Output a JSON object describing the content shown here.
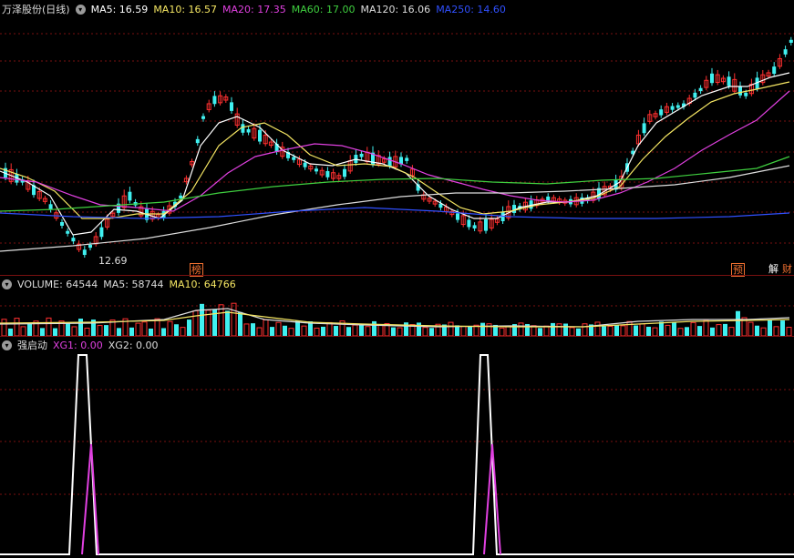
{
  "main": {
    "title": "万泽股份(日线)",
    "ma": [
      {
        "label": "MA5: 16.59",
        "color": "#ffffff"
      },
      {
        "label": "MA10: 16.57",
        "color": "#f5e663"
      },
      {
        "label": "MA20: 17.35",
        "color": "#e040e0"
      },
      {
        "label": "MA60: 17.00",
        "color": "#3fcf3f"
      },
      {
        "label": "MA120: 16.06",
        "color": "#dddddd"
      },
      {
        "label": "MA250: 14.60",
        "color": "#3050ff"
      }
    ],
    "low_label": "12.69",
    "tags": [
      {
        "text": "榜",
        "color": "#f07030"
      },
      {
        "text": "预",
        "color": "#f07030"
      },
      {
        "text": "解",
        "color": "#ffffff"
      },
      {
        "text": "财",
        "color": "#f07030"
      }
    ]
  },
  "volume": {
    "labels": [
      {
        "label": "VOLUME: 64544",
        "color": "#dddddd"
      },
      {
        "label": "MA5: 58744",
        "color": "#dddddd"
      },
      {
        "label": "MA10: 64766",
        "color": "#f5e663"
      }
    ]
  },
  "indicator": {
    "title": "强启动",
    "labels": [
      {
        "label": "XG1: 0.00",
        "color": "#e040e0"
      },
      {
        "label": "XG2: 0.00",
        "color": "#dddddd"
      }
    ]
  },
  "colors": {
    "up": "#ff3030",
    "down": "#40f0f0",
    "grid": "#7a1010"
  }
}
